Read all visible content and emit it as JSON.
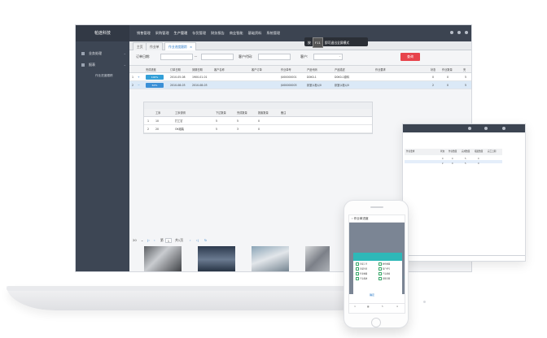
{
  "app": {
    "brand": "帕途科技",
    "top_nav": [
      "销售管理",
      "采购管理",
      "生产管理",
      "存货管理",
      "财务报告",
      "商业智能",
      "基础资料",
      "系统管理"
    ],
    "active_nav_index": 2
  },
  "sidebar": {
    "items": [
      {
        "label": "业务处理"
      },
      {
        "label": "报表"
      }
    ],
    "sub_items": [
      "作业进度跟踪"
    ]
  },
  "tabs": [
    {
      "label": "主页"
    },
    {
      "label": "作业单"
    },
    {
      "label": "作业进度跟踪"
    }
  ],
  "tooltip": {
    "before": "按",
    "key": "F11",
    "after": "即可退出全屏模式"
  },
  "filters": {
    "date_label": "订单日期:",
    "date_sep": "--",
    "customer_code_label": "客户代码:",
    "customer_label": "客户:",
    "search_label": "查询"
  },
  "grid": {
    "columns": [
      "完成进度",
      "订单日期",
      "到期日期",
      "客户名称",
      "客户订单",
      "作业单号",
      "产品代码",
      "产品描述",
      "作业要求",
      "状态",
      "作业数量",
      "完"
    ],
    "rows": [
      {
        "no": "1",
        "expand": "+",
        "progress": "100%",
        "progress_color": "#34a0d8",
        "order_date": "2010-05-08",
        "due_date": "1900-01-01",
        "customer": "",
        "cust_order": "",
        "job_no": "JU00000001",
        "product_code": "D0K0-1",
        "product_desc": "D0K0-1原料",
        "req": "",
        "status": "0",
        "qty": "0",
        "done": "5"
      },
      {
        "no": "2",
        "expand": "−",
        "progress": "60%",
        "progress_color": "#3a8fd6",
        "order_date": "2010-08-03",
        "due_date": "2010-08-03",
        "customer": "",
        "cust_order": "",
        "job_no": "JU00000003",
        "product_code": "卧室以柜以0",
        "product_desc": "卧室以柜以0",
        "req": "",
        "status": "2",
        "qty": "0",
        "done": "5"
      }
    ]
  },
  "subgrid": {
    "columns": [
      "",
      "工序",
      "工序说明",
      "下达数量",
      "完成数量",
      "报废数量",
      "备注"
    ],
    "rows": [
      {
        "no": "1",
        "step": "10",
        "desc": "打工钉",
        "issued": "5",
        "done": "5",
        "scrap": "0",
        "note": ""
      },
      {
        "no": "2",
        "step": "20",
        "desc": "OK组装",
        "issued": "5",
        "done": "3",
        "scrap": "0",
        "note": ""
      }
    ]
  },
  "pager": {
    "page_size": "20",
    "prefix": "第",
    "page": "1",
    "total": "共1页"
  },
  "tablet": {
    "columns": [
      "作业要求",
      "状态",
      "作业数量",
      "完成数量",
      "报废数量",
      "完工日期"
    ],
    "rows": [
      [
        "",
        "0",
        "0",
        "5",
        "0",
        ""
      ],
      [
        "",
        "2",
        "0",
        "5",
        "0",
        ""
      ]
    ]
  },
  "phone": {
    "title": "作业单进度",
    "options": [
      "完成工序",
      "剩余数量",
      "完成时间",
      "客户单号",
      "作业数量",
      "产品规格",
      "产品描述",
      "到期日期"
    ],
    "confirm": "确定"
  },
  "colors": {
    "topbar": "#3c4451",
    "sidebar": "#3d4654",
    "search_button": "#e7434b",
    "selected_row": "#dbe9f7",
    "accent": "#2b7bc8",
    "teal": "#2eb8b8"
  },
  "icons": [
    "expand-icon",
    "collapse-icon",
    "close-icon",
    "first-page-icon",
    "prev-page-icon",
    "next-page-icon",
    "last-page-icon",
    "refresh-icon",
    "chevron-down-icon",
    "back-icon"
  ]
}
